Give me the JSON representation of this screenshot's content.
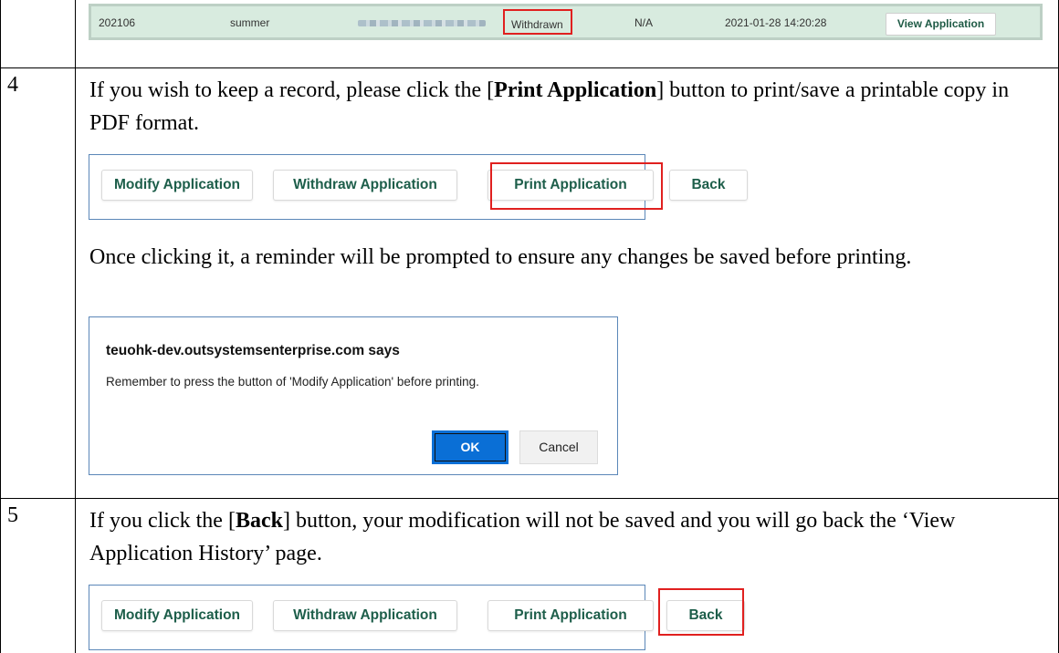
{
  "history_row": {
    "id": "202106",
    "season": "summer",
    "status": "Withdrawn",
    "result": "N/A",
    "datetime": "2021-01-28 14:20:28",
    "view_button": "View Application"
  },
  "step4": {
    "number": "4",
    "text_before": "If you wish to keep a record, please click the [",
    "bold": "Print Application",
    "text_after": "] button to print/save a printable copy in PDF format.",
    "reminder_text": "Once clicking it, a reminder will be prompted to ensure any changes be saved before printing."
  },
  "buttons": {
    "modify": "Modify Application",
    "withdraw": "Withdraw Application",
    "print": "Print Application",
    "back": "Back"
  },
  "dialog": {
    "title": "teuohk-dev.outsystemsenterprise.com says",
    "message": "Remember to press the button of 'Modify Application' before printing.",
    "ok": "OK",
    "cancel": "Cancel"
  },
  "step5": {
    "number": "5",
    "text_before": "If you click the [",
    "bold": "Back",
    "text_after": "] button, your modification will not be saved and you will go back the ‘View Application History’ page."
  },
  "colors": {
    "highlight": "#e0201f",
    "button_text": "#1d5e4a",
    "frame_blue": "#5b87b8",
    "row_green": "#d8ebdf",
    "ok_blue": "#0a6fd6"
  }
}
